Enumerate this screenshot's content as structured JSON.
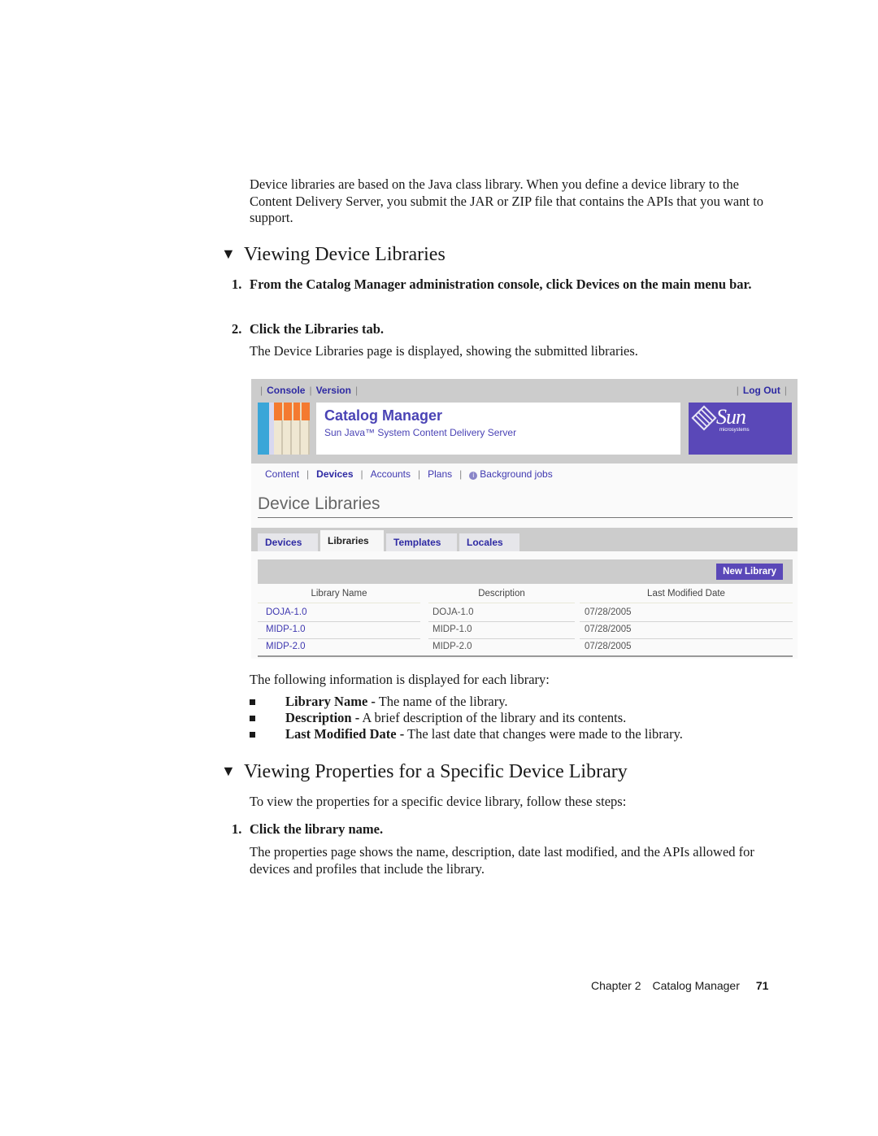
{
  "intro": "Device libraries are based on the Java class library. When you define a device library to the Content Delivery Server, you submit the JAR or ZIP file that contains the APIs that you want to support.",
  "section1": {
    "heading": "Viewing Device Libraries",
    "steps": [
      {
        "num": "1.",
        "text": "From the Catalog Manager administration console, click Devices on the main menu bar."
      },
      {
        "num": "2.",
        "text": "Click the Libraries tab."
      }
    ],
    "result": "The Device Libraries page is displayed, showing the submitted libraries."
  },
  "screenshot": {
    "utility_left": [
      "Console",
      "Version"
    ],
    "utility_right": [
      "Log Out"
    ],
    "app_title": "Catalog Manager",
    "app_subtitle": "Sun Java™ System Content Delivery Server",
    "brand": {
      "word": "Sun",
      "micro": "microsystems",
      "color": "#5a48b8"
    },
    "main_nav": [
      {
        "label": "Content",
        "active": false
      },
      {
        "label": "Devices",
        "active": true
      },
      {
        "label": "Accounts",
        "active": false
      },
      {
        "label": "Plans",
        "active": false
      },
      {
        "label": "Background jobs",
        "active": false,
        "icon": "info-circle-icon"
      }
    ],
    "page_title": "Device Libraries",
    "tabs": [
      {
        "label": "Devices",
        "active": false
      },
      {
        "label": "Libraries",
        "active": true
      },
      {
        "label": "Templates",
        "active": false
      },
      {
        "label": "Locales",
        "active": false
      }
    ],
    "new_button": "New Library",
    "table": {
      "columns": [
        "Library Name",
        "Description",
        "Last Modified Date"
      ],
      "rows": [
        [
          "DOJA-1.0",
          "DOJA-1.0",
          "07/28/2005"
        ],
        [
          "MIDP-1.0",
          "MIDP-1.0",
          "07/28/2005"
        ],
        [
          "MIDP-2.0",
          "MIDP-2.0",
          "07/28/2005"
        ]
      ]
    }
  },
  "info_intro": "The following information is displayed for each library:",
  "info_bullets": [
    {
      "term": "Library Name -",
      "desc": " The name of the library."
    },
    {
      "term": "Description -",
      "desc": " A brief description of the library and its contents."
    },
    {
      "term": "Last Modified Date -",
      "desc": " The last date that changes were made to the library."
    }
  ],
  "section2": {
    "heading": "Viewing Properties for a Specific Device Library",
    "intro": "To view the properties for a specific device library, follow these steps:",
    "steps": [
      {
        "num": "1.",
        "text": "Click the library name."
      }
    ],
    "result": "The properties page shows the name, description, date last modified, and the APIs allowed for devices and profiles that include the library."
  },
  "footer": {
    "chapter": "Chapter 2",
    "title": "Catalog Manager",
    "page": "71"
  }
}
